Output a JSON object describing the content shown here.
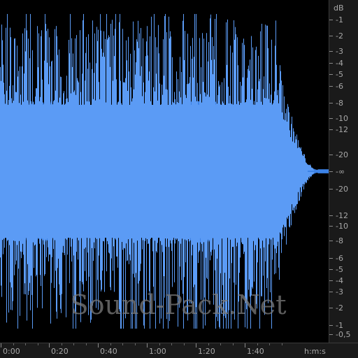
{
  "colors": {
    "background": "#000000",
    "waveform": "#3c82e6",
    "waveform_edge": "#5b9bf5",
    "ruler_bg": "#1a1a1a",
    "label": "#a8a8a8"
  },
  "db_scale": {
    "unit": "dB",
    "labels": [
      "-1",
      "-2",
      "-3",
      "-4",
      "-5",
      "-6",
      "-8",
      "-10",
      "-12",
      "-20",
      "-∞",
      "-20",
      "-12",
      "-10",
      "-8",
      "-6",
      "-5",
      "-4",
      "-3",
      "-2",
      "-1",
      "-0,5"
    ]
  },
  "time_ruler": {
    "labels": [
      "0:00",
      "0:20",
      "0:40",
      "1:00",
      "1:20",
      "1:40"
    ],
    "unit": "h:m:s"
  },
  "watermark": "Sound-Pack.Net",
  "waveform": {
    "duration_label": "approx 2:00",
    "fade_out_starts": "1:40"
  }
}
